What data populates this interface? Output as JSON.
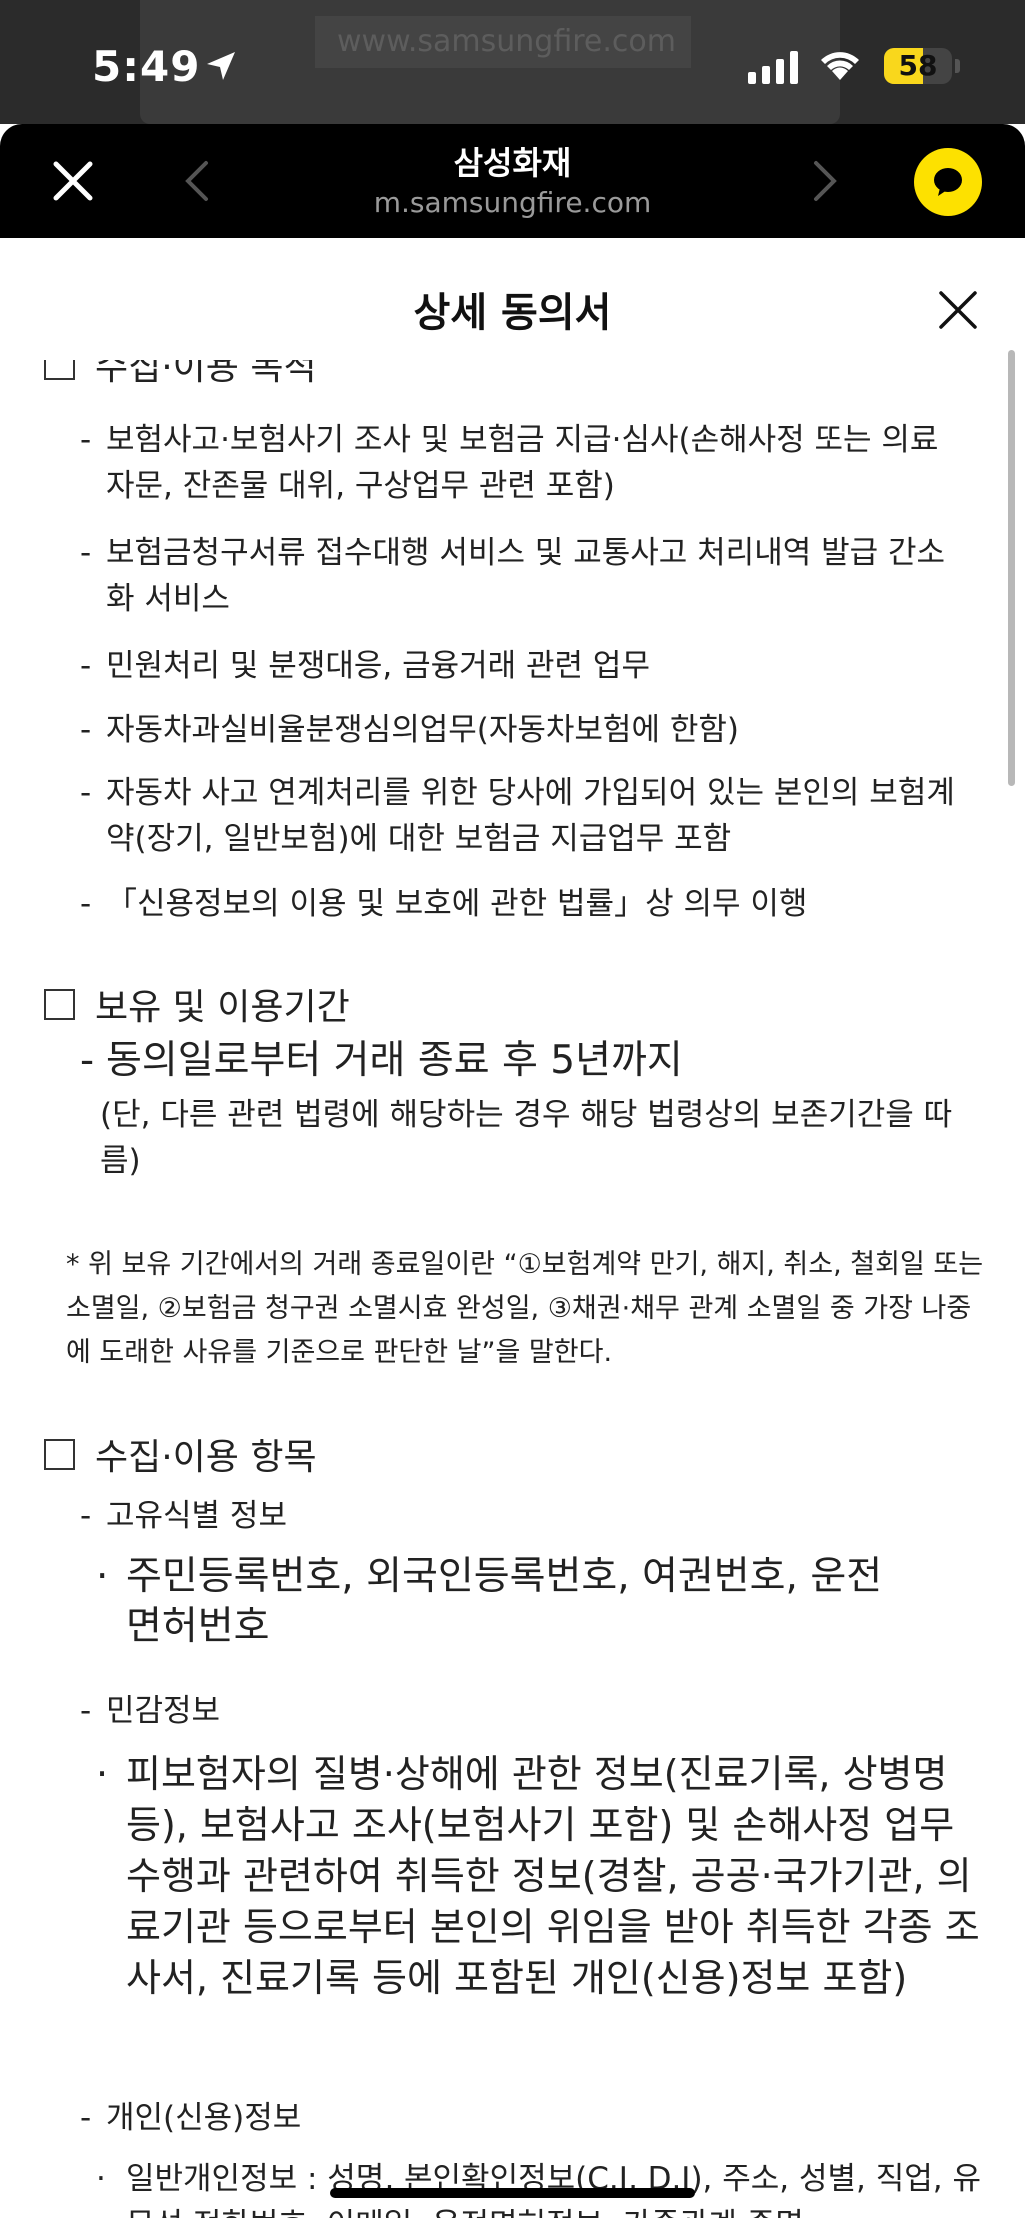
{
  "status_bar": {
    "time": "5:49",
    "battery": "58",
    "battery_level": 0.58,
    "ghost_url": "www.samsungfire.com"
  },
  "nav": {
    "title": "삼성화재",
    "url": "m.samsungfire.com"
  },
  "header": {
    "title": "상세 동의서"
  },
  "sections": {
    "purpose_partial_heading": "수집·이용 목적",
    "purpose_items": [
      "보험사고·보험사기 조사 및 보험금 지급·심사(손해사정 또는 의료자문, 잔존물 대위, 구상업무 관련 포함)",
      "보험금청구서류 접수대행 서비스 및 교통사고 처리내역 발급 간소화 서비스",
      "민원처리 및 분쟁대응, 금융거래 관련 업무",
      "자동차과실비율분쟁심의업무(자동차보험에 한함)",
      "자동차 사고 연계처리를 위한 당사에 가입되어 있는 본인의 보험계약(장기, 일반보험)에 대한 보험금 지급업무 포함",
      "「신용정보의 이용 및 보호에 관한 법률」상 의무 이행"
    ],
    "retention_heading": "보유 및 이용기간",
    "retention_main": "동의일로부터 거래 종료 후 5년까지",
    "retention_sub": "(단, 다른 관련 법령에 해당하는 경우 해당 법령상의 보존기간을 따름)",
    "retention_note": "* 위 보유 기간에서의 거래 종료일이란 “①보험계약 만기, 해지, 취소, 철회일 또는 소멸일, ②보험금 청구권 소멸시효 완성일, ③채권·채무 관계 소멸일 중 가장 나중에 도래한 사유를 기준으로 판단한 날”을 말한다.",
    "items_heading": "수집·이용 항목",
    "unique_id_label": "고유식별 정보",
    "unique_id_value": "주민등록번호, 외국인등록번호, 여권번호, 운전면허번호",
    "sensitive_label": "민감정보",
    "sensitive_value": "피보험자의 질병·상해에 관한 정보(진료기록, 상병명 등), 보험사고 조사(보험사기 포함) 및 손해사정 업무 수행과 관련하여 취득한 정보(경찰, 공공·국가기관, 의료기관 등으로부터 본인의 위임을 받아 취득한 각종 조사서, 진료기록 등에 포함된 개인(신용)정보 포함)",
    "personal_label": "개인(신용)정보",
    "personal_value": "일반개인정보 : 성명, 본인확인정보(C.I, D.I), 주소, 성별, 직업, 유무선 전화번호, 이메일, 운전면허정보, 가족관계 증명"
  }
}
